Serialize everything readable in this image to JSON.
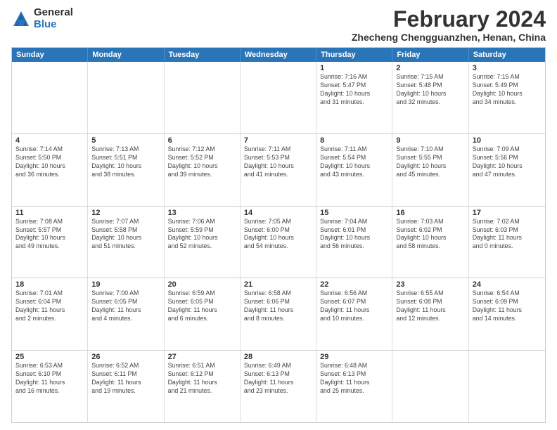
{
  "header": {
    "logo_general": "General",
    "logo_blue": "Blue",
    "title": "February 2024",
    "location": "Zhecheng Chengguanzhen, Henan, China"
  },
  "days_of_week": [
    "Sunday",
    "Monday",
    "Tuesday",
    "Wednesday",
    "Thursday",
    "Friday",
    "Saturday"
  ],
  "rows": [
    [
      {
        "day": "",
        "detail": ""
      },
      {
        "day": "",
        "detail": ""
      },
      {
        "day": "",
        "detail": ""
      },
      {
        "day": "",
        "detail": ""
      },
      {
        "day": "1",
        "detail": "Sunrise: 7:16 AM\nSunset: 5:47 PM\nDaylight: 10 hours\nand 31 minutes."
      },
      {
        "day": "2",
        "detail": "Sunrise: 7:15 AM\nSunset: 5:48 PM\nDaylight: 10 hours\nand 32 minutes."
      },
      {
        "day": "3",
        "detail": "Sunrise: 7:15 AM\nSunset: 5:49 PM\nDaylight: 10 hours\nand 34 minutes."
      }
    ],
    [
      {
        "day": "4",
        "detail": "Sunrise: 7:14 AM\nSunset: 5:50 PM\nDaylight: 10 hours\nand 36 minutes."
      },
      {
        "day": "5",
        "detail": "Sunrise: 7:13 AM\nSunset: 5:51 PM\nDaylight: 10 hours\nand 38 minutes."
      },
      {
        "day": "6",
        "detail": "Sunrise: 7:12 AM\nSunset: 5:52 PM\nDaylight: 10 hours\nand 39 minutes."
      },
      {
        "day": "7",
        "detail": "Sunrise: 7:11 AM\nSunset: 5:53 PM\nDaylight: 10 hours\nand 41 minutes."
      },
      {
        "day": "8",
        "detail": "Sunrise: 7:11 AM\nSunset: 5:54 PM\nDaylight: 10 hours\nand 43 minutes."
      },
      {
        "day": "9",
        "detail": "Sunrise: 7:10 AM\nSunset: 5:55 PM\nDaylight: 10 hours\nand 45 minutes."
      },
      {
        "day": "10",
        "detail": "Sunrise: 7:09 AM\nSunset: 5:56 PM\nDaylight: 10 hours\nand 47 minutes."
      }
    ],
    [
      {
        "day": "11",
        "detail": "Sunrise: 7:08 AM\nSunset: 5:57 PM\nDaylight: 10 hours\nand 49 minutes."
      },
      {
        "day": "12",
        "detail": "Sunrise: 7:07 AM\nSunset: 5:58 PM\nDaylight: 10 hours\nand 51 minutes."
      },
      {
        "day": "13",
        "detail": "Sunrise: 7:06 AM\nSunset: 5:59 PM\nDaylight: 10 hours\nand 52 minutes."
      },
      {
        "day": "14",
        "detail": "Sunrise: 7:05 AM\nSunset: 6:00 PM\nDaylight: 10 hours\nand 54 minutes."
      },
      {
        "day": "15",
        "detail": "Sunrise: 7:04 AM\nSunset: 6:01 PM\nDaylight: 10 hours\nand 56 minutes."
      },
      {
        "day": "16",
        "detail": "Sunrise: 7:03 AM\nSunset: 6:02 PM\nDaylight: 10 hours\nand 58 minutes."
      },
      {
        "day": "17",
        "detail": "Sunrise: 7:02 AM\nSunset: 6:03 PM\nDaylight: 11 hours\nand 0 minutes."
      }
    ],
    [
      {
        "day": "18",
        "detail": "Sunrise: 7:01 AM\nSunset: 6:04 PM\nDaylight: 11 hours\nand 2 minutes."
      },
      {
        "day": "19",
        "detail": "Sunrise: 7:00 AM\nSunset: 6:05 PM\nDaylight: 11 hours\nand 4 minutes."
      },
      {
        "day": "20",
        "detail": "Sunrise: 6:59 AM\nSunset: 6:05 PM\nDaylight: 11 hours\nand 6 minutes."
      },
      {
        "day": "21",
        "detail": "Sunrise: 6:58 AM\nSunset: 6:06 PM\nDaylight: 11 hours\nand 8 minutes."
      },
      {
        "day": "22",
        "detail": "Sunrise: 6:56 AM\nSunset: 6:07 PM\nDaylight: 11 hours\nand 10 minutes."
      },
      {
        "day": "23",
        "detail": "Sunrise: 6:55 AM\nSunset: 6:08 PM\nDaylight: 11 hours\nand 12 minutes."
      },
      {
        "day": "24",
        "detail": "Sunrise: 6:54 AM\nSunset: 6:09 PM\nDaylight: 11 hours\nand 14 minutes."
      }
    ],
    [
      {
        "day": "25",
        "detail": "Sunrise: 6:53 AM\nSunset: 6:10 PM\nDaylight: 11 hours\nand 16 minutes."
      },
      {
        "day": "26",
        "detail": "Sunrise: 6:52 AM\nSunset: 6:11 PM\nDaylight: 11 hours\nand 19 minutes."
      },
      {
        "day": "27",
        "detail": "Sunrise: 6:51 AM\nSunset: 6:12 PM\nDaylight: 11 hours\nand 21 minutes."
      },
      {
        "day": "28",
        "detail": "Sunrise: 6:49 AM\nSunset: 6:13 PM\nDaylight: 11 hours\nand 23 minutes."
      },
      {
        "day": "29",
        "detail": "Sunrise: 6:48 AM\nSunset: 6:13 PM\nDaylight: 11 hours\nand 25 minutes."
      },
      {
        "day": "",
        "detail": ""
      },
      {
        "day": "",
        "detail": ""
      }
    ]
  ]
}
